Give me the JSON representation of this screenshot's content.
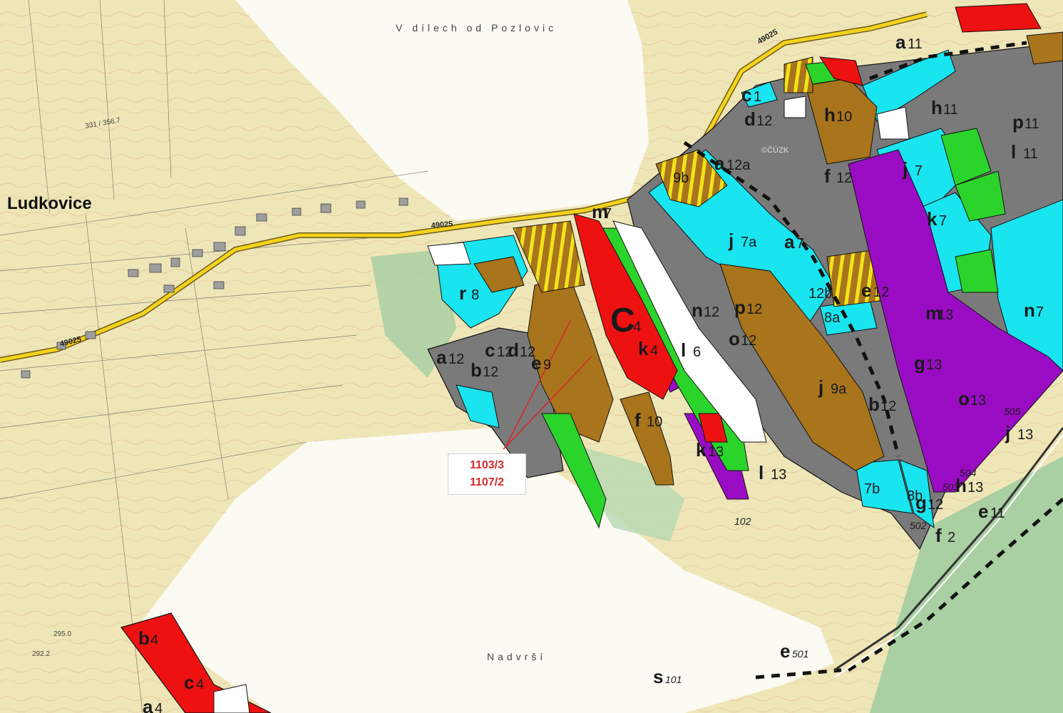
{
  "place_name": "Ludkovice",
  "field_names": {
    "top": "V dílech od Pozlovic",
    "bottom": "Nadvrší"
  },
  "road_number": "49025",
  "watermark": "©ČÚZK",
  "spot_heights": [
    "331 / 356.7",
    "295.0",
    "292.2"
  ],
  "callout": {
    "parcel_1": "1103/3",
    "parcel_2": "1107/2"
  },
  "legend_colors": {
    "gray": "#7a7a7a",
    "cyan": "#19e5f0",
    "brown": "#a8741c",
    "purple": "#9a0cc4",
    "green": "#2bd42b",
    "red": "#ee1111",
    "yellow": "#f2e21a",
    "white": "#ffffff"
  },
  "parcels": [
    {
      "letter": "a",
      "num": "12"
    },
    {
      "letter": "b",
      "num": "12"
    },
    {
      "letter": "c",
      "num": "12"
    },
    {
      "letter": "d",
      "num": "12"
    },
    {
      "letter": "e",
      "num": "9"
    },
    {
      "letter": "r",
      "num": "8"
    },
    {
      "letter": "C",
      "num": "4"
    },
    {
      "letter": "k",
      "num": "4"
    },
    {
      "letter": "m",
      "num": "7"
    },
    {
      "letter": "n",
      "num": "12"
    },
    {
      "letter": "p",
      "num": "12"
    },
    {
      "letter": "o",
      "num": "12"
    },
    {
      "letter": "l",
      "num": "6"
    },
    {
      "letter": "j",
      "num": "9a"
    },
    {
      "letter": "b",
      "num": "12"
    },
    {
      "letter": "a",
      "num": "7"
    },
    {
      "letter": "j",
      "num": "7a"
    },
    {
      "letter": "e",
      "num": "12"
    },
    {
      "letter": "g",
      "num": "13"
    },
    {
      "letter": "m",
      "num": "13"
    },
    {
      "letter": "n",
      "num": "7"
    },
    {
      "letter": "o",
      "num": "13"
    },
    {
      "letter": "k",
      "num": "7"
    },
    {
      "letter": "j",
      "num": "7"
    },
    {
      "letter": "f",
      "num": "12"
    },
    {
      "letter": "a",
      "num": "12a"
    },
    {
      "letter": "d",
      "num": "12"
    },
    {
      "letter": "h",
      "num": "10"
    },
    {
      "letter": "h",
      "num": "11"
    },
    {
      "letter": "p",
      "num": "11"
    },
    {
      "letter": "l",
      "num": "11"
    },
    {
      "letter": "c",
      "num": "1"
    },
    {
      "letter": "a",
      "num": "11"
    },
    {
      "letter": "k",
      "num": "13"
    },
    {
      "letter": "l",
      "num": "13"
    },
    {
      "letter": "f",
      "num": "10"
    },
    {
      "letter": "j",
      "num": "13"
    },
    {
      "letter": "h",
      "num": "13"
    },
    {
      "letter": "e",
      "num": "11"
    },
    {
      "letter": "g",
      "num": "12"
    },
    {
      "letter": "f",
      "num": "2"
    },
    {
      "letter": "b",
      "num": "4"
    },
    {
      "letter": "c",
      "num": "4"
    },
    {
      "letter": "a",
      "num": "4"
    },
    {
      "letter": "s",
      "num": "101"
    },
    {
      "letter": "e",
      "num": "501"
    },
    {
      "letter": "",
      "num": "102"
    },
    {
      "letter": "",
      "num": "9b"
    },
    {
      "letter": "",
      "num": "8a"
    },
    {
      "letter": "",
      "num": "12b"
    },
    {
      "letter": "",
      "num": "7b"
    },
    {
      "letter": "",
      "num": "8b"
    },
    {
      "letter": "",
      "num": "502"
    },
    {
      "letter": "",
      "num": "503"
    },
    {
      "letter": "",
      "num": "504"
    },
    {
      "letter": "",
      "num": "505"
    }
  ]
}
